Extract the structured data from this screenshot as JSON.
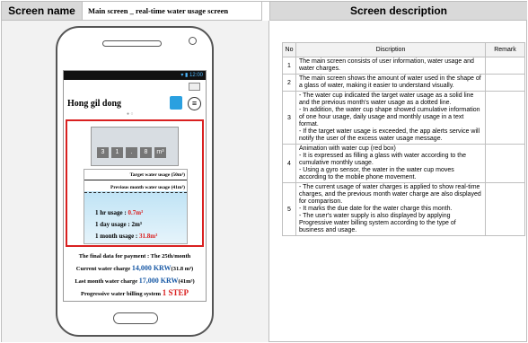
{
  "header": {
    "screen_name_label": "Screen name",
    "screen_title": "Main screen _ real-time water usage screen",
    "screen_description_label": "Screen description"
  },
  "phone": {
    "status_time": "12:00",
    "user_name": "Hong gil dong",
    "meter_digits": [
      "3",
      "1",
      ".",
      "8",
      "m³"
    ],
    "target_line": "Target water usage (50m³)",
    "previous_line": "Previous month water usage (41m³)",
    "hour_label": "1 hr usage : ",
    "hour_value": "0.7m³",
    "day_label": "1 day usage : 2m³",
    "month_label": "1 month usage : ",
    "month_value": "31.8m³",
    "payment_date": "The final data for payment : The 25th/month",
    "current_charge_label": "Current water charge ",
    "current_charge_value": "14,000 KRW",
    "current_charge_unit": "(31.8 m³)",
    "last_charge_label": "Last month water charge ",
    "last_charge_value": "17,000 KRW",
    "last_charge_unit": "(41m³)",
    "billing_label": "Progressive water billing system ",
    "billing_step": "1 STEP"
  },
  "table": {
    "headers": [
      "No",
      "Discription",
      "Remark"
    ],
    "rows": [
      {
        "no": "1",
        "desc": "The main screen consists of user information, water usage and water charges."
      },
      {
        "no": "2",
        "desc": "The main screen shows the amount of water used in the shape of a glass of water, making it easier to understand visually."
      },
      {
        "no": "3",
        "desc": "- The water cup indicated the target water usage as a solid line and the previous month's water usage as a dotted line.\n- In addition, the water cup shape showed cumulative information of one hour usage, daily usage and monthly usage in a text format.\n- If the target water usage is exceeded, the app alerts service will notify the user of the excess water usage message."
      },
      {
        "no": "4",
        "desc": "Animation with water cup (red box)\n- It is expressed as filling a glass with water according to the cumulative monthly usage.\n- Using a gyro sensor, the water in the water cup moves according to the mobile phone movement."
      },
      {
        "no": "5",
        "desc": "- The current usage of water charges is applied to show real-time charges, and the previous month water charge are also displayed for comparison.\n- It marks the due date for the water charge this month.\n- The user's water supply is also displayed by applying Progressive water billing system according to the type of business and usage."
      }
    ]
  }
}
